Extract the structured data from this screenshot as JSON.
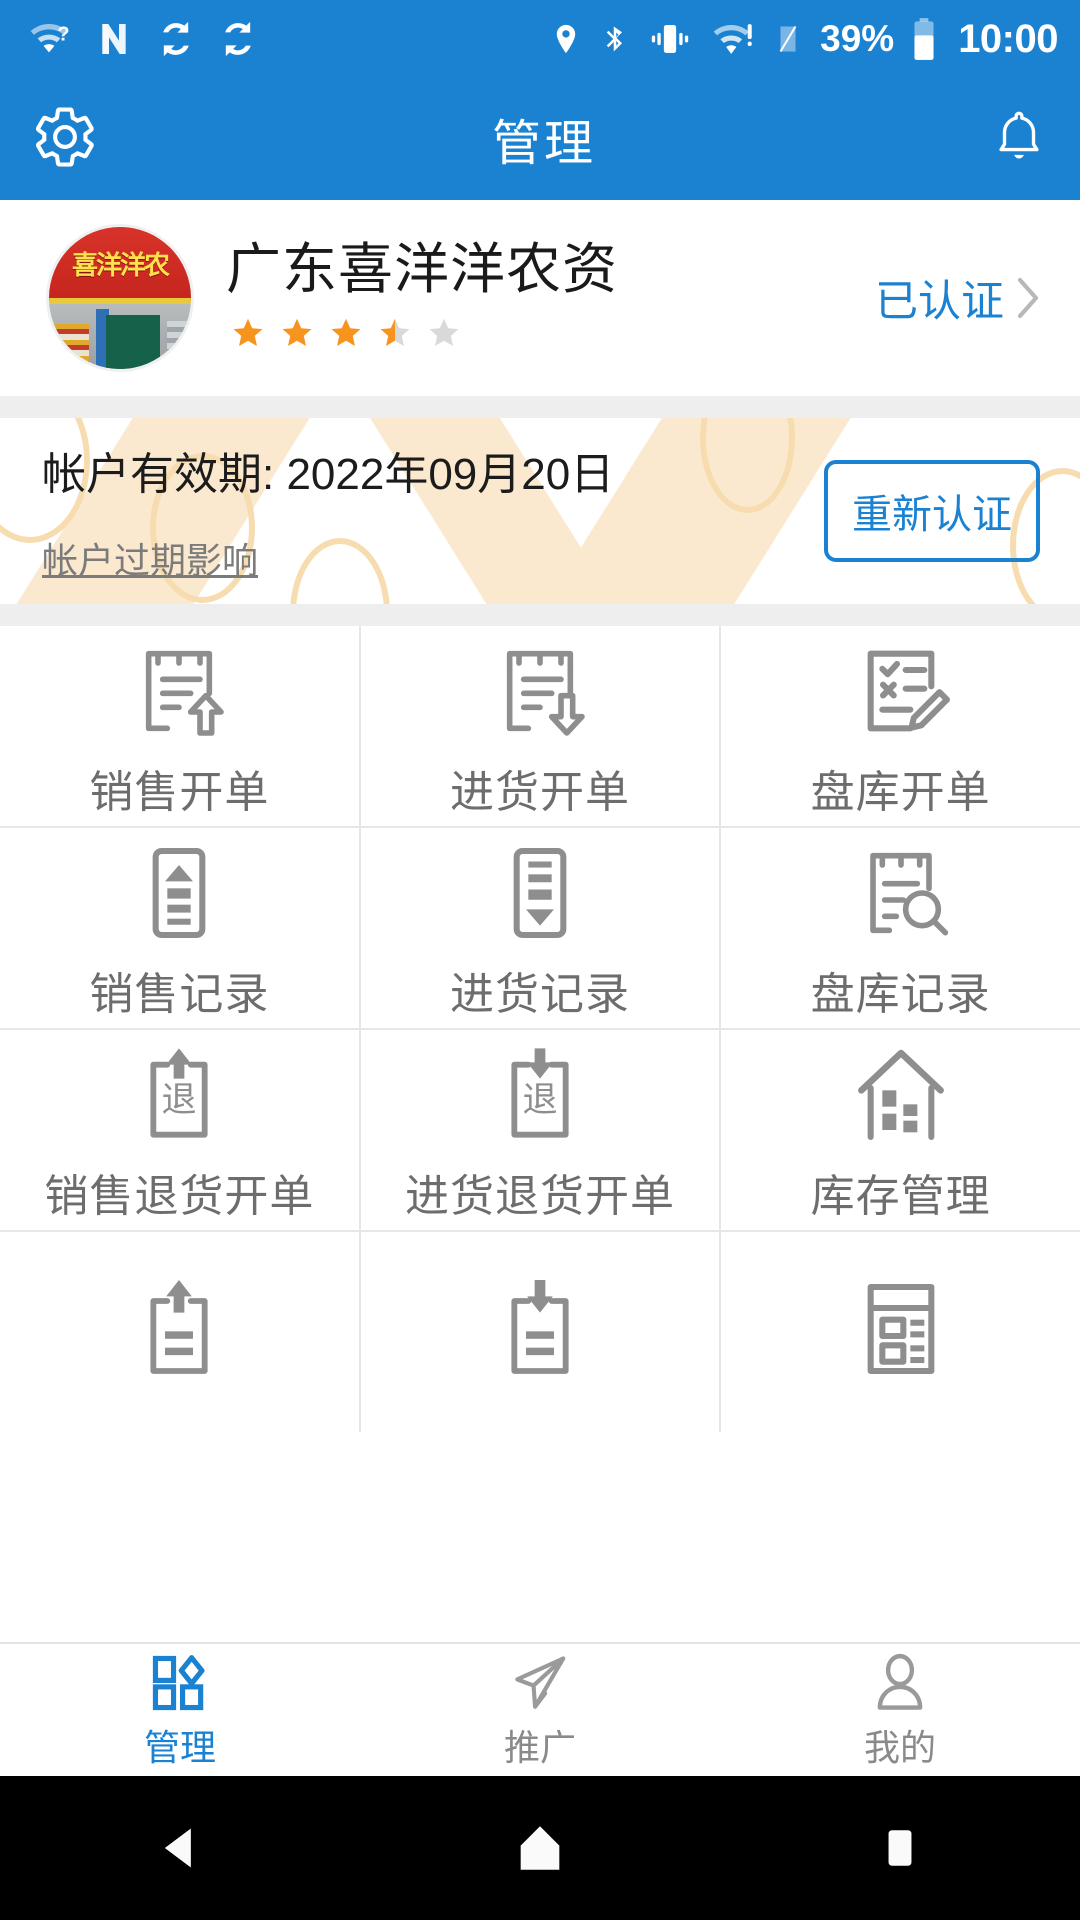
{
  "status_bar": {
    "left_icons": [
      "wifi-question-icon",
      "nfc-icon",
      "sync-icon",
      "sync-icon"
    ],
    "right_icons": [
      "location-icon",
      "bluetooth-icon",
      "vibrate-icon",
      "wifi-alert-icon",
      "sim-icon"
    ],
    "battery_percent": "39%",
    "clock": "10:00"
  },
  "app_bar": {
    "title": "管理",
    "settings_icon": "gear-icon",
    "notification_icon": "bell-icon"
  },
  "profile": {
    "shop_name": "广东喜洋洋农资",
    "avatar_sign_text": "喜洋洋农",
    "rating": 3.5,
    "rating_max": 5,
    "verified_label": "已认证",
    "chevron_icon": "chevron-right-icon"
  },
  "account": {
    "expiry_label": "帐户有效期: 2022年09月20日",
    "impact_link": "帐户过期影响",
    "recertify_button": "重新认证"
  },
  "grid": {
    "items": [
      {
        "label": "销售开单",
        "icon": "doc-arrow-up-icon"
      },
      {
        "label": "进货开单",
        "icon": "doc-arrow-down-icon"
      },
      {
        "label": "盘库开单",
        "icon": "checklist-pencil-icon"
      },
      {
        "label": "销售记录",
        "icon": "list-up-icon"
      },
      {
        "label": "进货记录",
        "icon": "list-down-icon"
      },
      {
        "label": "盘库记录",
        "icon": "doc-search-icon"
      },
      {
        "label": "销售退货开单",
        "icon": "return-up-icon"
      },
      {
        "label": "进货退货开单",
        "icon": "return-down-icon"
      },
      {
        "label": "库存管理",
        "icon": "warehouse-icon"
      },
      {
        "label": "",
        "icon": "receipt-up-icon"
      },
      {
        "label": "",
        "icon": "receipt-down-icon"
      },
      {
        "label": "",
        "icon": "ledger-icon"
      }
    ]
  },
  "tab_bar": {
    "tabs": [
      {
        "label": "管理",
        "icon": "grid-shapes-icon",
        "active": true
      },
      {
        "label": "推广",
        "icon": "paper-plane-icon",
        "active": false
      },
      {
        "label": "我的",
        "icon": "person-icon",
        "active": false
      }
    ]
  },
  "android_nav": {
    "back_icon": "triangle-back-icon",
    "home_icon": "pentagon-home-icon",
    "recents_icon": "square-recents-icon"
  },
  "colors": {
    "brand_blue": "#1b82d2",
    "star_orange": "#f7941d",
    "icon_gray": "#8e8e8e",
    "page_gray": "#eeeeee"
  }
}
